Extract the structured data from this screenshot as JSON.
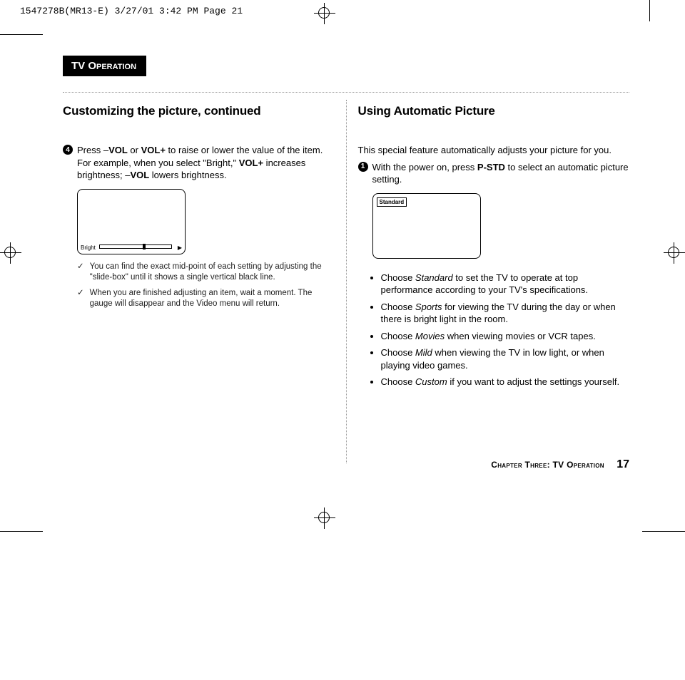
{
  "slug": "1547278B(MR13-E)  3/27/01 3:42 PM  Page 21",
  "section_title": "TV Operation",
  "left": {
    "heading": "Customizing the picture, continued",
    "step_num": "4",
    "step_text_parts": {
      "p1": "Press –",
      "vol": "VOL",
      "p2": " or ",
      "volp": "VOL+",
      "p3": " to raise or lower the value of the item. For example, when you select \"Bright,\" ",
      "volp2": "VOL+",
      "p4": " increases brightness; –",
      "vol2": "VOL",
      "p5": " lowers brightness."
    },
    "tv_label": "Bright",
    "checks": [
      "You can find the exact mid-point of each setting by adjusting the \"slide-box\" until it shows a single vertical black line.",
      "When you are finished adjusting an item, wait a moment. The gauge will disappear and the Video menu will return."
    ]
  },
  "right": {
    "heading": "Using Automatic Picture",
    "intro": "This special feature automatically adjusts your picture for you.",
    "step_num": "1",
    "step_text_parts": {
      "p1": "With the power on, press ",
      "pstd": "P-STD",
      "p2": " to select an automatic picture setting."
    },
    "tv_tag": "Standard",
    "bullets": [
      {
        "em": "Standard",
        "rest": " to set the TV to operate at top performance according to your TV's specifications."
      },
      {
        "em": "Sports",
        "rest": " for viewing the TV during the day or when there is bright light in the room."
      },
      {
        "em": "Movies",
        "rest": " when viewing movies or VCR tapes."
      },
      {
        "em": "Mild",
        "rest": " when viewing the TV in low light, or when playing video games."
      },
      {
        "em": "Custom",
        "rest": " if you want to adjust the settings yourself."
      }
    ],
    "bullet_prefix": "Choose "
  },
  "footer_chapter": "Chapter Three: TV Operation",
  "footer_page": "17"
}
